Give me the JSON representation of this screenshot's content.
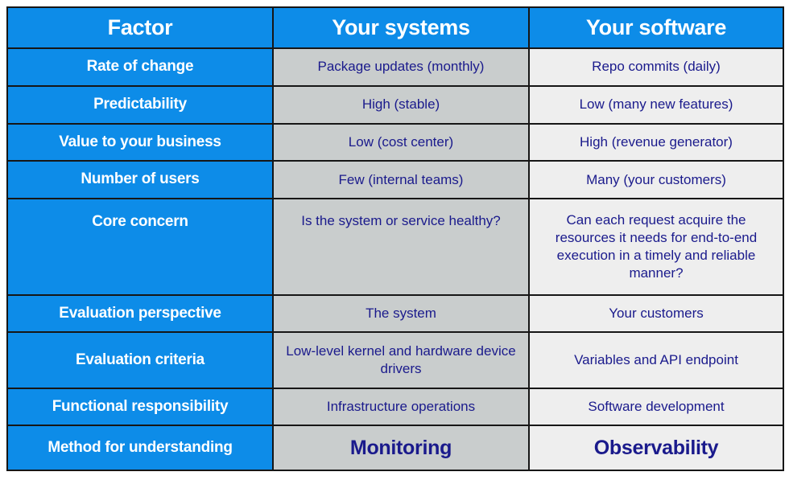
{
  "colors": {
    "header_blue": "#0d8ce8",
    "factor_blue": "#0d8ce8",
    "systems_gray": "#c9cdcd",
    "software_gray": "#eeeeee",
    "body_text_navy": "#1a1a8c",
    "header_text": "#ffffff",
    "border": "#161616"
  },
  "table": {
    "columns": [
      {
        "key": "factor",
        "label": "Factor"
      },
      {
        "key": "systems",
        "label": "Your systems"
      },
      {
        "key": "software",
        "label": "Your software"
      }
    ],
    "rows": [
      {
        "factor": "Rate of change",
        "systems": "Package updates (monthly)",
        "software": "Repo commits (daily)"
      },
      {
        "factor": "Predictability",
        "systems": "High (stable)",
        "software": "Low (many new features)"
      },
      {
        "factor": "Value to your business",
        "systems": "Low (cost center)",
        "software": "High (revenue generator)"
      },
      {
        "factor": "Number of users",
        "systems": "Few (internal teams)",
        "software": "Many (your customers)"
      },
      {
        "factor": "Core concern",
        "systems": "Is the system or service healthy?",
        "software": "Can each request acquire the resources it needs for end-to-end execution in a timely and reliable manner?"
      },
      {
        "factor": "Evaluation perspective",
        "systems": "The system",
        "software": "Your customers"
      },
      {
        "factor": "Evaluation criteria",
        "systems": "Low-level kernel and hardware device drivers",
        "software": "Variables and API endpoint"
      },
      {
        "factor": "Functional responsibility",
        "systems": "Infrastructure operations",
        "software": "Software development"
      },
      {
        "factor": "Method for understanding",
        "systems": "Monitoring",
        "software": "Observability"
      }
    ]
  }
}
